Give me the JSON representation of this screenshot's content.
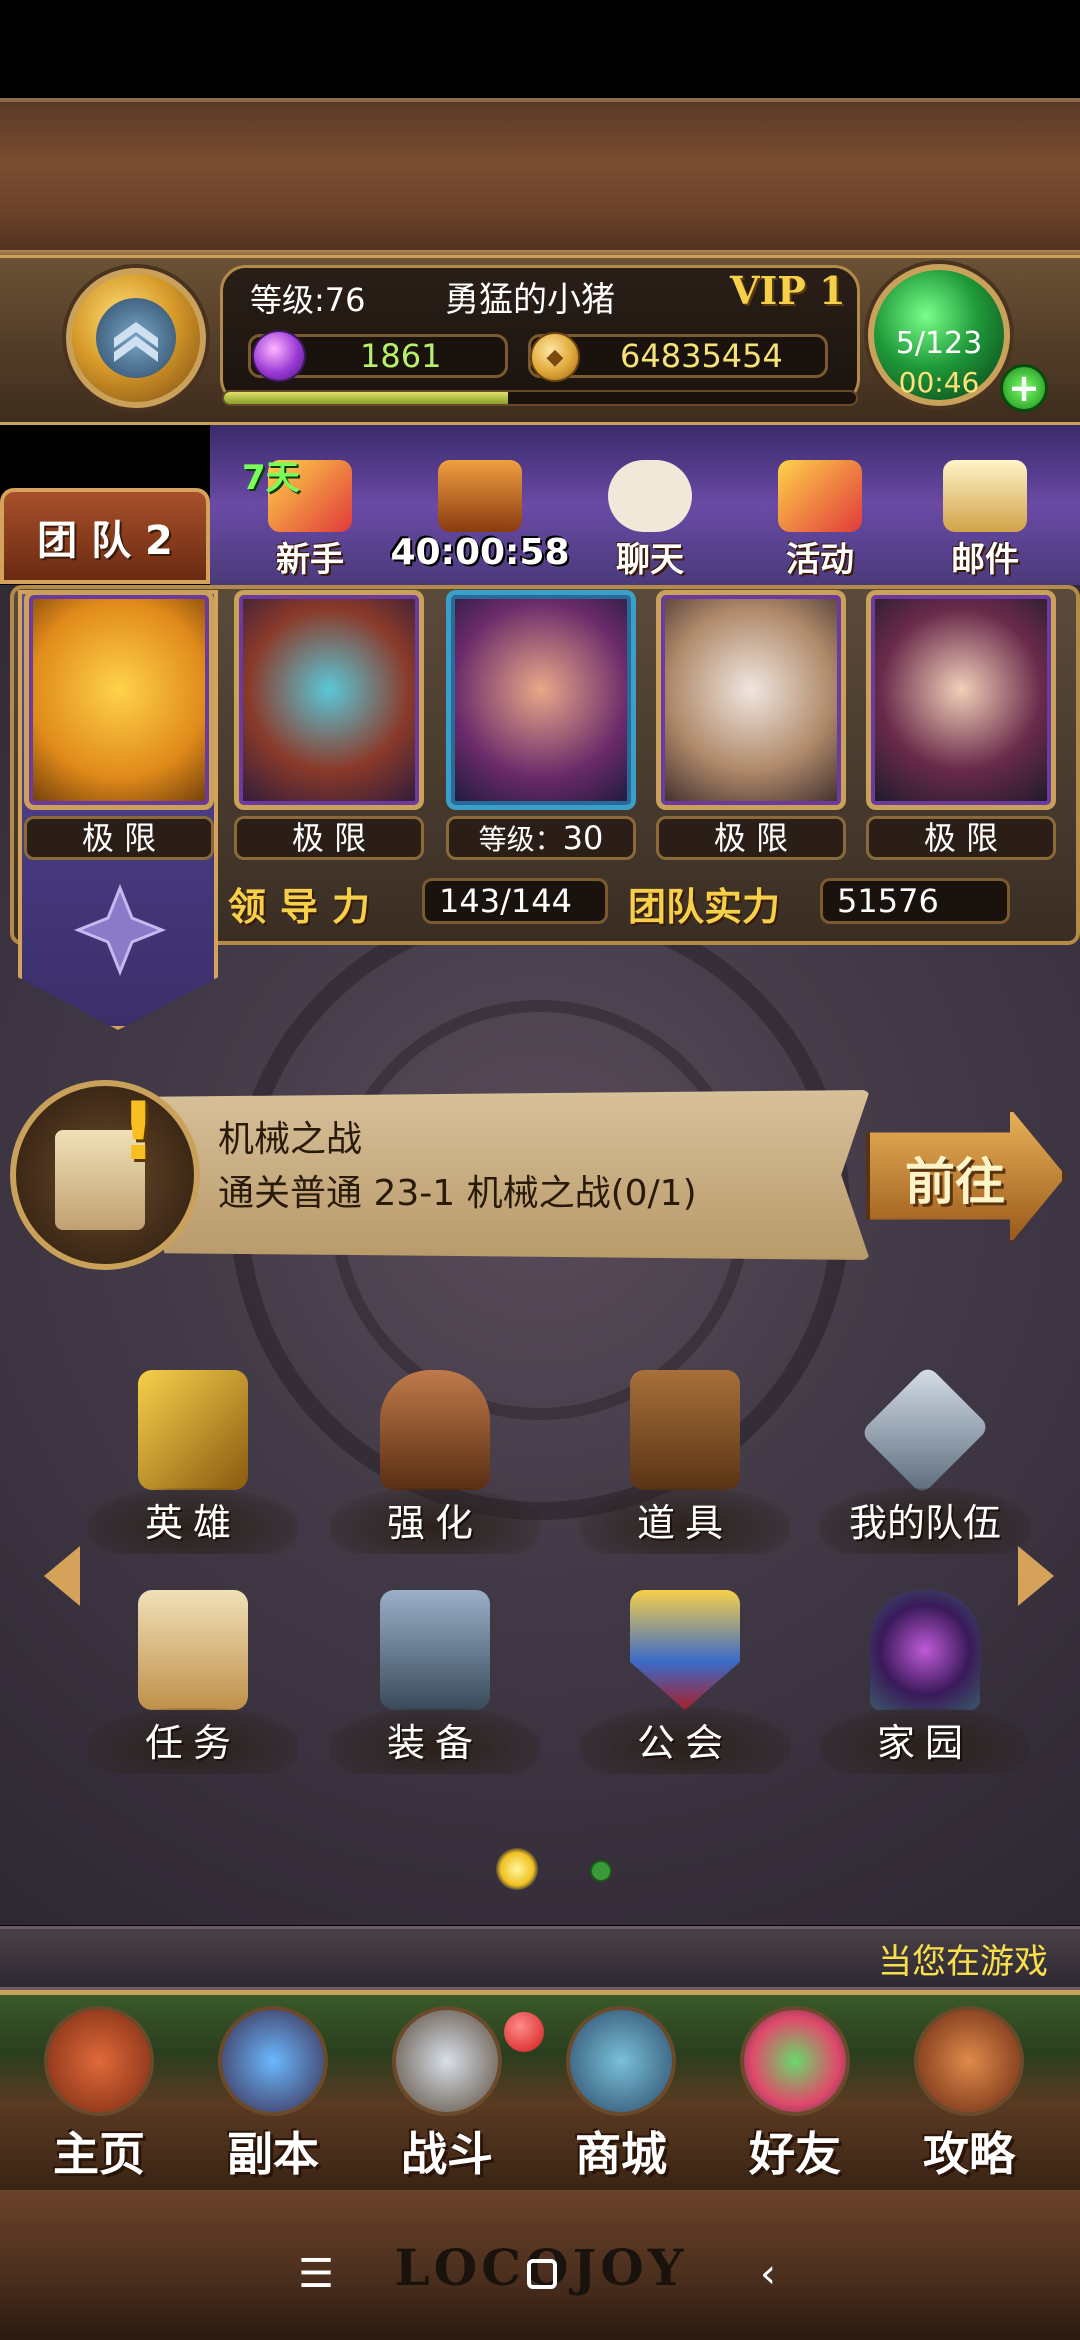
{
  "player": {
    "level_label": "等级:76",
    "name": "勇猛的小猪",
    "vip": "VIP 1",
    "gems": "1861",
    "coins": "64835454",
    "exp_fraction": 0.45
  },
  "energy": {
    "count": "5/123",
    "timer": "00:46",
    "plus": "+"
  },
  "team_tab": "团 队 2",
  "events": {
    "newbie": {
      "days": "7天",
      "label": "新手"
    },
    "chest_countdown": "40:00:58",
    "chat": "聊天",
    "activity": "活动",
    "mail": "邮件"
  },
  "heroes": [
    {
      "tag": "极 限"
    },
    {
      "tag": "极 限"
    },
    {
      "tag_prefix": "等级：",
      "tag_value": "30"
    },
    {
      "tag": "极 限"
    },
    {
      "tag": "极 限"
    }
  ],
  "stats": {
    "leadership_label": "领导力",
    "leadership_value": "143/144",
    "power_label": "团队实力",
    "power_value": "51576"
  },
  "quest": {
    "title": "机械之战",
    "description": "通关普通 23-1 机械之战(0/1)",
    "alert": "!",
    "go_label": "前往"
  },
  "features": {
    "hero": "英雄",
    "enhance": "强化",
    "items": "道具",
    "team": "我的队伍",
    "quest": "任务",
    "equip": "装备",
    "guild": "公会",
    "home": "家园"
  },
  "pager": {
    "pages": 2,
    "current": 1
  },
  "marquee": "当您在游戏",
  "nav": {
    "home": "主页",
    "dungeon": "副本",
    "battle": "战斗",
    "shop": "商城",
    "friends": "好友",
    "guide": "攻略"
  },
  "logo": "LOCOJOY",
  "colors": {
    "gold": "#c9a15a",
    "vip": "#f7d04a",
    "gem_text": "#b8f06a",
    "coin_text": "#f7e27a"
  }
}
